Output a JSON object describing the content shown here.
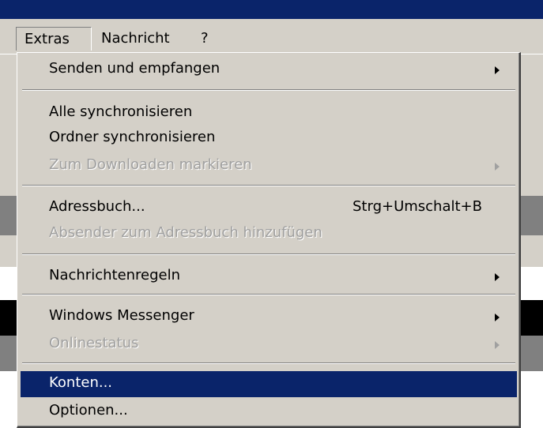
{
  "menubar": {
    "items": [
      {
        "label": "Extras"
      },
      {
        "label": "Nachricht"
      },
      {
        "label": "?"
      }
    ]
  },
  "menu": {
    "items": [
      {
        "label": "Senden und empfangen",
        "submenu": true,
        "disabled": false
      },
      {
        "label": "Alle synchronisieren",
        "submenu": false,
        "disabled": false
      },
      {
        "label": "Ordner synchronisieren",
        "submenu": false,
        "disabled": false
      },
      {
        "label": "Zum Downloaden markieren",
        "submenu": true,
        "disabled": true
      },
      {
        "label": "Adressbuch...",
        "shortcut": "Strg+Umschalt+B",
        "submenu": false,
        "disabled": false
      },
      {
        "label": "Absender zum Adressbuch hinzufügen",
        "submenu": false,
        "disabled": true
      },
      {
        "label": "Nachrichtenregeln",
        "submenu": true,
        "disabled": false
      },
      {
        "label": "Windows Messenger",
        "submenu": true,
        "disabled": false
      },
      {
        "label": "Onlinestatus",
        "submenu": true,
        "disabled": true
      },
      {
        "label": "Konten...",
        "submenu": false,
        "disabled": false,
        "selected": true
      },
      {
        "label": "Optionen...",
        "submenu": false,
        "disabled": false
      }
    ]
  },
  "colors": {
    "face": "#d4d0c8",
    "highlight": "#0a246a",
    "disabled_text": "#a0a0a0"
  }
}
